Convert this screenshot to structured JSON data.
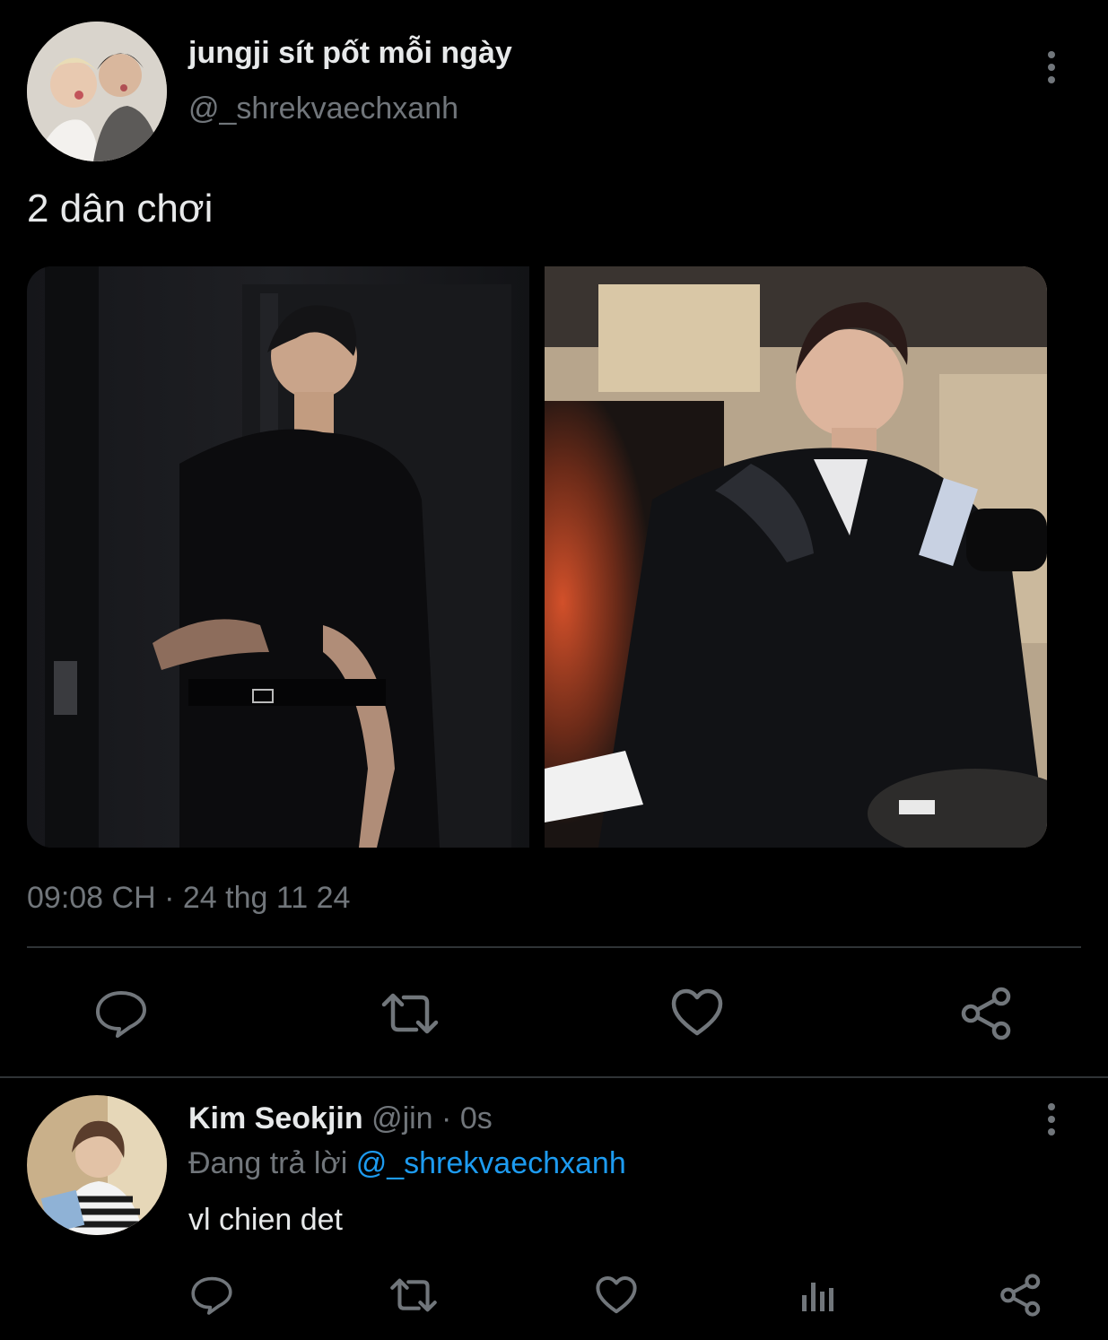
{
  "tweet": {
    "author_name": "jungji sít pốt mỗi ngày",
    "author_handle": "@_shrekvaechxanh",
    "text": "2 dân chơi",
    "timestamp": "09:08 CH · 24 thg 11 24",
    "avatar_icon": "avatar-photo-two-people",
    "more_icon": "more-vertical-icon",
    "images": [
      {
        "description_icon": "photo-left"
      },
      {
        "description_icon": "photo-right"
      }
    ],
    "actions": [
      "reply-icon",
      "retweet-icon",
      "like-icon",
      "share-icon"
    ]
  },
  "reply": {
    "author_name": "Kim Seokjin",
    "author_handle": "@jin",
    "separator": "·",
    "time": "0s",
    "replying_prefix": "Đang trả lời",
    "replying_to": "@_shrekvaechxanh",
    "text": "vl chien det",
    "actions": [
      "reply-icon",
      "retweet-icon",
      "like-icon",
      "analytics-icon",
      "share-icon"
    ]
  },
  "colors": {
    "background": "#000000",
    "text": "#e7e9ea",
    "muted": "#71767b",
    "link": "#1d9bf0",
    "divider": "#2f3336"
  }
}
